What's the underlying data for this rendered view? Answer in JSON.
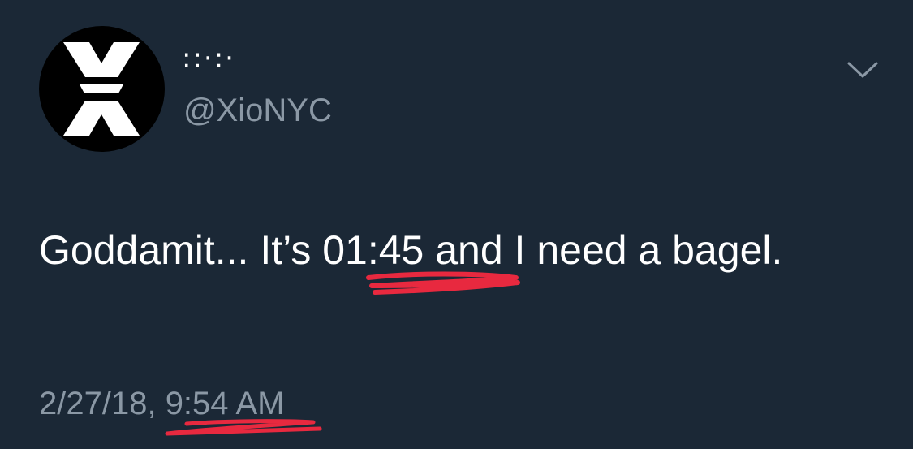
{
  "author": {
    "display_name": "::·:·",
    "handle": "@XioNYC",
    "avatar_icon": "x-logo-icon"
  },
  "menu": {
    "icon": "chevron-down-icon"
  },
  "tweet": {
    "text_parts": [
      "Goddamit... It’s ",
      "01:45",
      " and I need a bagel."
    ],
    "timestamp_date": "2/27/18, ",
    "timestamp_time": "9:54 AM"
  },
  "colors": {
    "background": "#1b2836",
    "text": "#ffffff",
    "secondary_text": "#8b98a5",
    "highlight": "#e8293f"
  }
}
